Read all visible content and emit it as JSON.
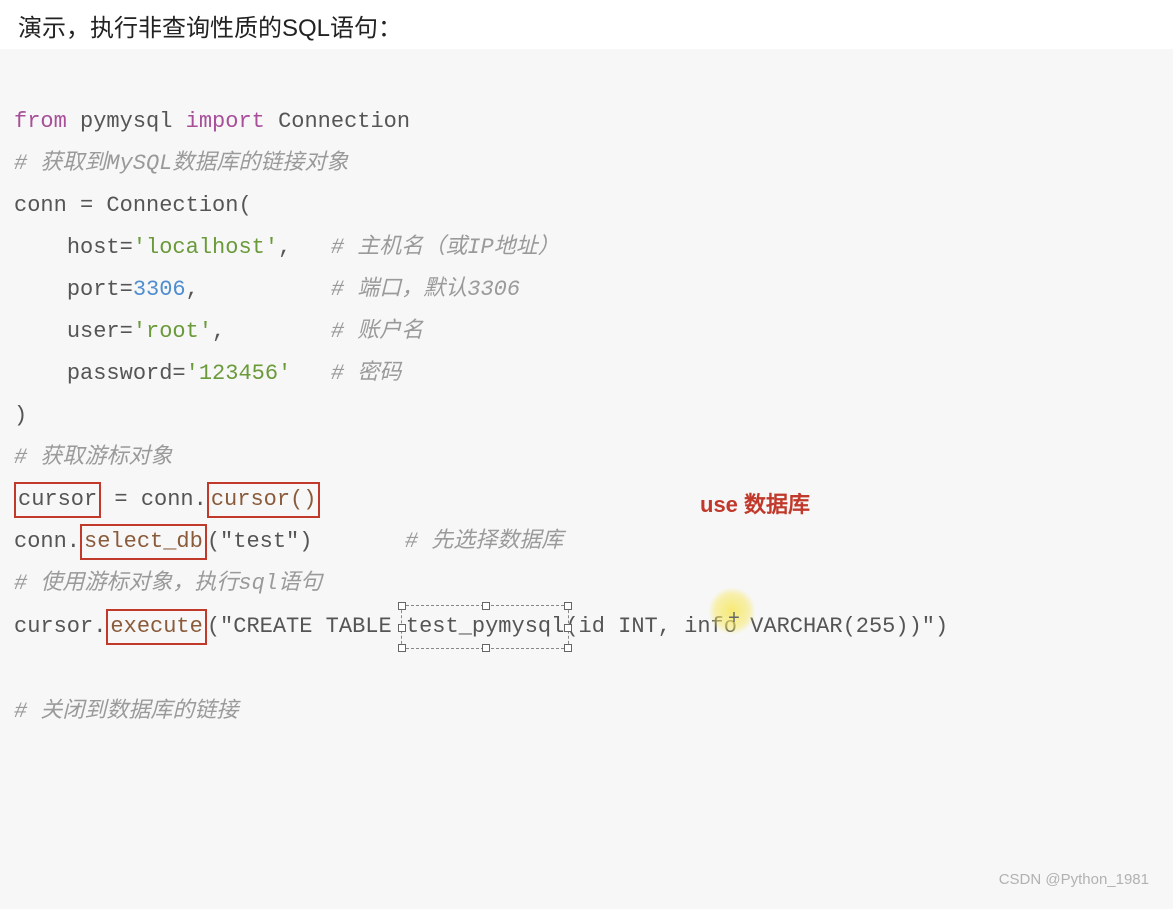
{
  "heading": "演示，执行非查询性质的SQL语句：",
  "code": {
    "l1": {
      "kw1": "from",
      "mod": "pymysql",
      "kw2": "import",
      "cls": "Connection"
    },
    "l2": "# 获取到MySQL数据库的链接对象",
    "l3": {
      "var": "conn",
      "eq": "=",
      "cls": "Connection",
      "paren": "("
    },
    "l4": {
      "indent": "    ",
      "key": "host=",
      "val": "'localhost'",
      "comma": ",",
      "cmt": "# 主机名（或IP地址）"
    },
    "l5": {
      "indent": "    ",
      "key": "port=",
      "val": "3306",
      "comma": ",",
      "cmt": "# 端口，默认3306"
    },
    "l6": {
      "indent": "    ",
      "key": "user=",
      "val": "'root'",
      "comma": ",",
      "cmt": "# 账户名"
    },
    "l7": {
      "indent": "    ",
      "key": "password=",
      "val": "'123456'",
      "cmt": "# 密码"
    },
    "l8": ")",
    "l9": "# 获取游标对象",
    "l10": {
      "lhs": "cursor",
      "eq": "= conn.",
      "call": "cursor()"
    },
    "l11": {
      "pre": "conn.",
      "call": "select_db",
      "arg": "(\"test\")",
      "cmt": "# 先选择数据库"
    },
    "annot11": "use 数据库",
    "l12": "# 使用游标对象，执行sql语句",
    "l13": {
      "pre": "cursor.",
      "call": "execute",
      "open": "(\"CREATE TABLE ",
      "sel": "test_pymysql",
      "rest": "(id INT, info VARCHAR(255))\")"
    },
    "l14": "# 关闭到数据库的链接"
  },
  "watermark": "CSDN @Python_1981"
}
